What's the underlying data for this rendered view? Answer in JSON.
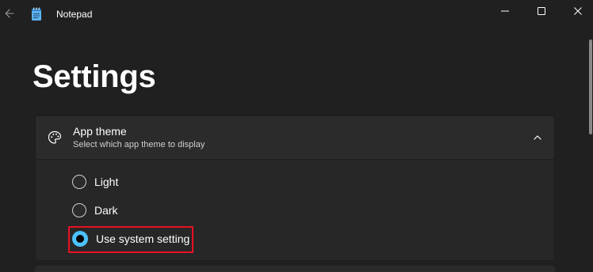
{
  "window": {
    "title": "Notepad",
    "controls": [
      "minimize",
      "maximize",
      "close"
    ]
  },
  "titlebar": {
    "back_icon": "back-arrow-icon",
    "app_icon": "notepad-icon"
  },
  "page": {
    "title": "Settings"
  },
  "app_theme": {
    "title": "App theme",
    "description": "Select which app theme to display",
    "icon": "palette-icon",
    "expanded": true,
    "options": [
      {
        "label": "Light",
        "selected": false
      },
      {
        "label": "Dark",
        "selected": false
      },
      {
        "label": "Use system setting",
        "selected": true
      }
    ]
  },
  "colors": {
    "background": "#202020",
    "card": "#2b2b2b",
    "accent": "#4cc2ff",
    "highlight": "#e81123"
  }
}
